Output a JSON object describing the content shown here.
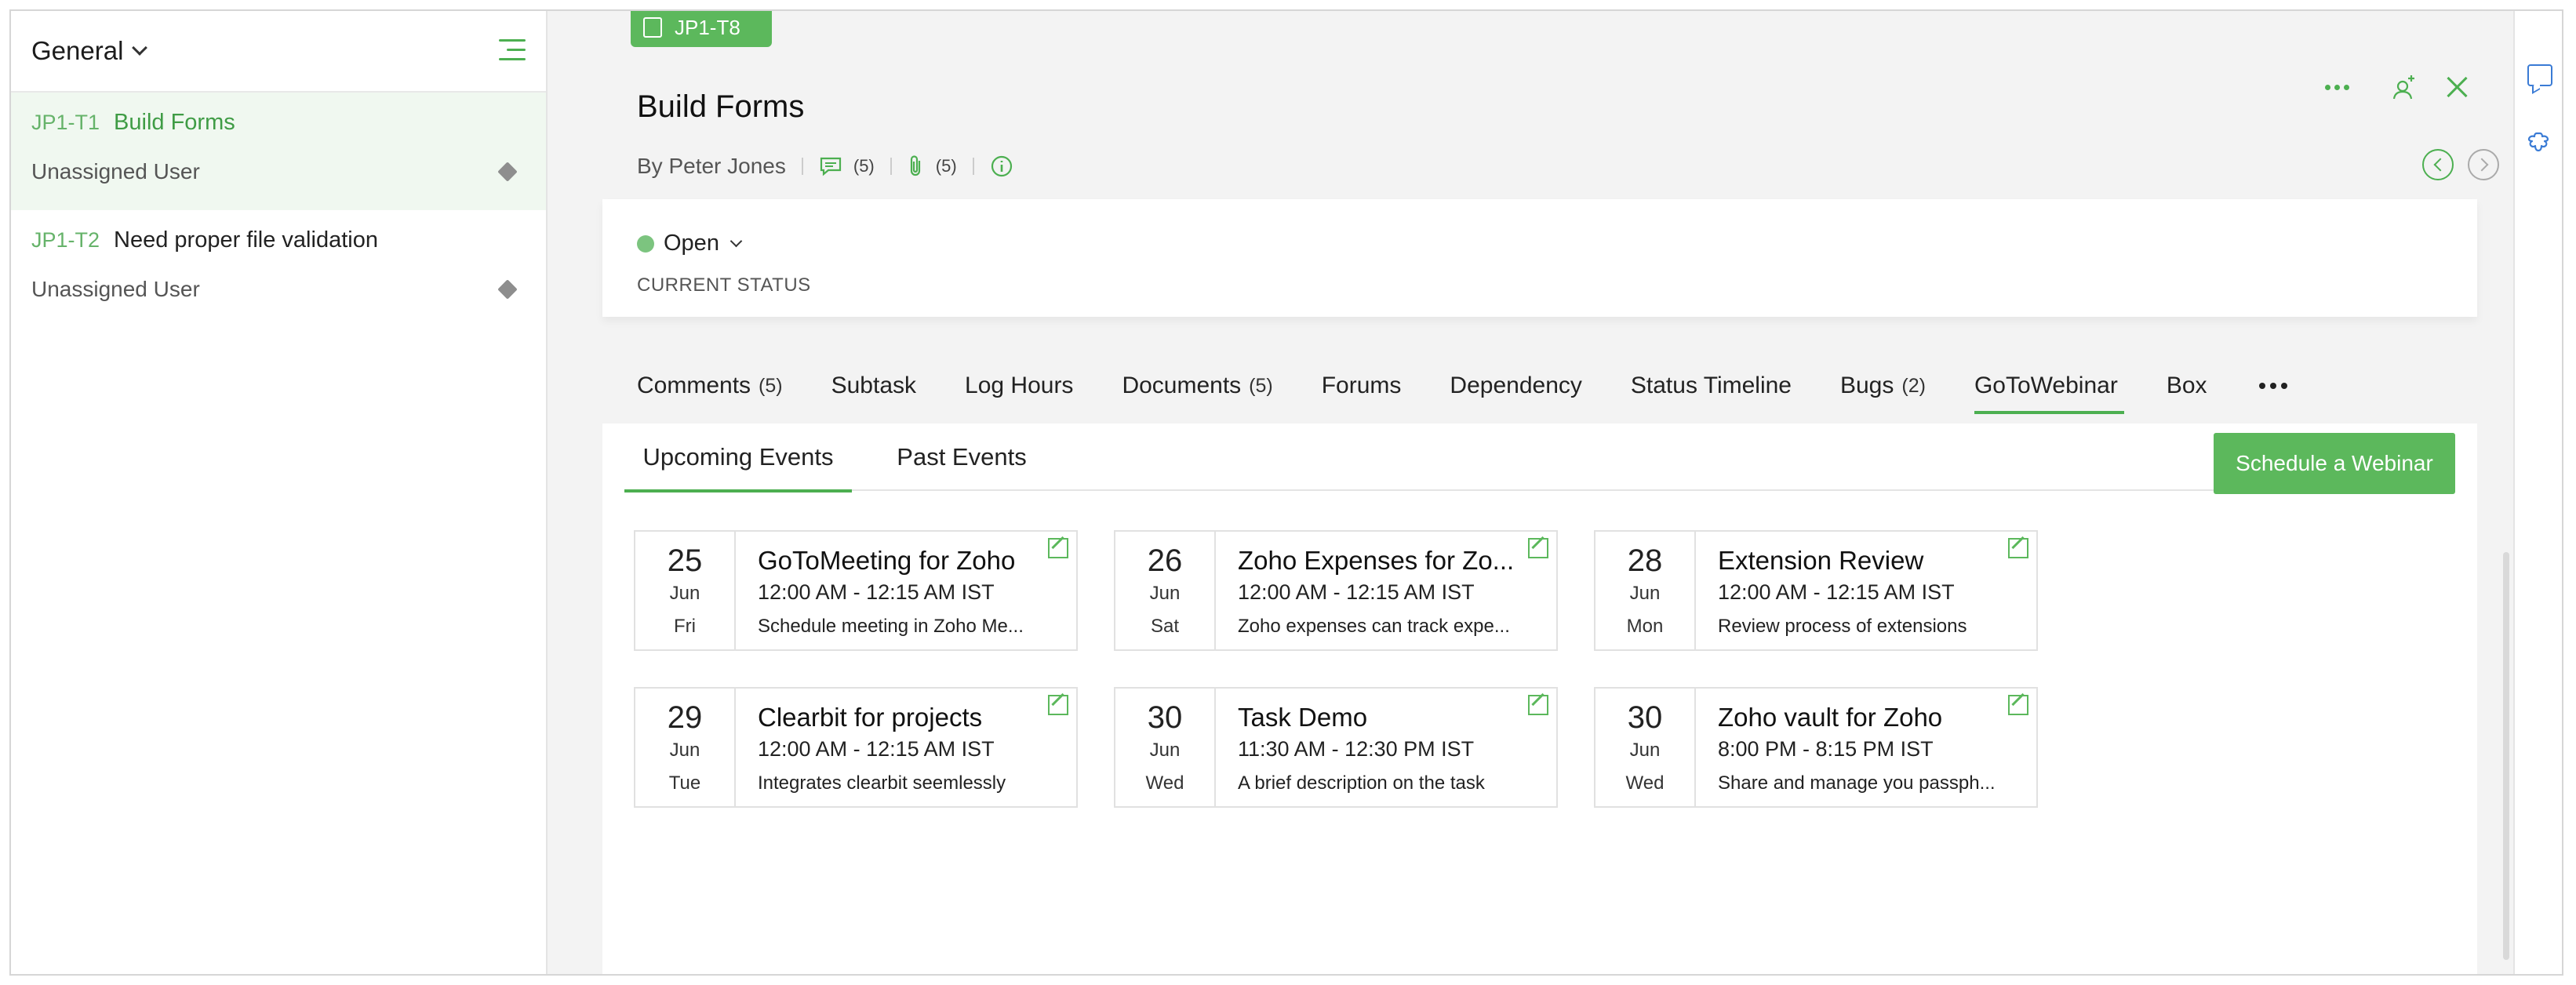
{
  "sidebar": {
    "project": "General",
    "tasks": [
      {
        "id": "JP1-T1",
        "title": "Build Forms",
        "user": "Unassigned User",
        "active": true
      },
      {
        "id": "JP1-T2",
        "title": "Need proper file validation",
        "user": "Unassigned User",
        "active": false
      }
    ]
  },
  "header": {
    "task_key": "JP1-T8",
    "title": "Build Forms",
    "author": "By Peter Jones",
    "comments_count": "(5)",
    "attachments_count": "(5)"
  },
  "status": {
    "value": "Open",
    "label": "CURRENT STATUS",
    "color": "#7cc47f"
  },
  "tabs": [
    {
      "label": "Comments",
      "count": "(5)"
    },
    {
      "label": "Subtask",
      "count": ""
    },
    {
      "label": "Log Hours",
      "count": ""
    },
    {
      "label": "Documents",
      "count": "(5)"
    },
    {
      "label": "Forums",
      "count": ""
    },
    {
      "label": "Dependency",
      "count": ""
    },
    {
      "label": "Status Timeline",
      "count": ""
    },
    {
      "label": "Bugs",
      "count": "(2)"
    },
    {
      "label": "GoToWebinar",
      "count": ""
    },
    {
      "label": "Box",
      "count": ""
    }
  ],
  "webinar": {
    "subtabs": [
      "Upcoming Events",
      "Past Events"
    ],
    "schedule_label": "Schedule a Webinar",
    "events": [
      {
        "day": "25",
        "month": "Jun",
        "weekday": "Fri",
        "title": "GoToMeeting for Zoho",
        "time": "12:00 AM - 12:15 AM IST",
        "desc": "Schedule meeting in Zoho Me..."
      },
      {
        "day": "26",
        "month": "Jun",
        "weekday": "Sat",
        "title": "Zoho Expenses for Zo...",
        "time": "12:00 AM - 12:15 AM IST",
        "desc": "Zoho expenses can track expe..."
      },
      {
        "day": "28",
        "month": "Jun",
        "weekday": "Mon",
        "title": "Extension Review",
        "time": "12:00 AM - 12:15 AM IST",
        "desc": "Review process of extensions"
      },
      {
        "day": "29",
        "month": "Jun",
        "weekday": "Tue",
        "title": "Clearbit for projects",
        "time": "12:00 AM - 12:15 AM IST",
        "desc": "Integrates clearbit seemlessly"
      },
      {
        "day": "30",
        "month": "Jun",
        "weekday": "Wed",
        "title": "Task Demo",
        "time": "11:30 AM - 12:30 PM IST",
        "desc": "A brief description on the task"
      },
      {
        "day": "30",
        "month": "Jun",
        "weekday": "Wed",
        "title": "Zoho vault for Zoho",
        "time": "8:00 PM - 8:15 PM IST",
        "desc": "Share and manage you passph..."
      }
    ]
  },
  "colors": {
    "accent": "#4caf50",
    "button": "#5cb85c"
  }
}
